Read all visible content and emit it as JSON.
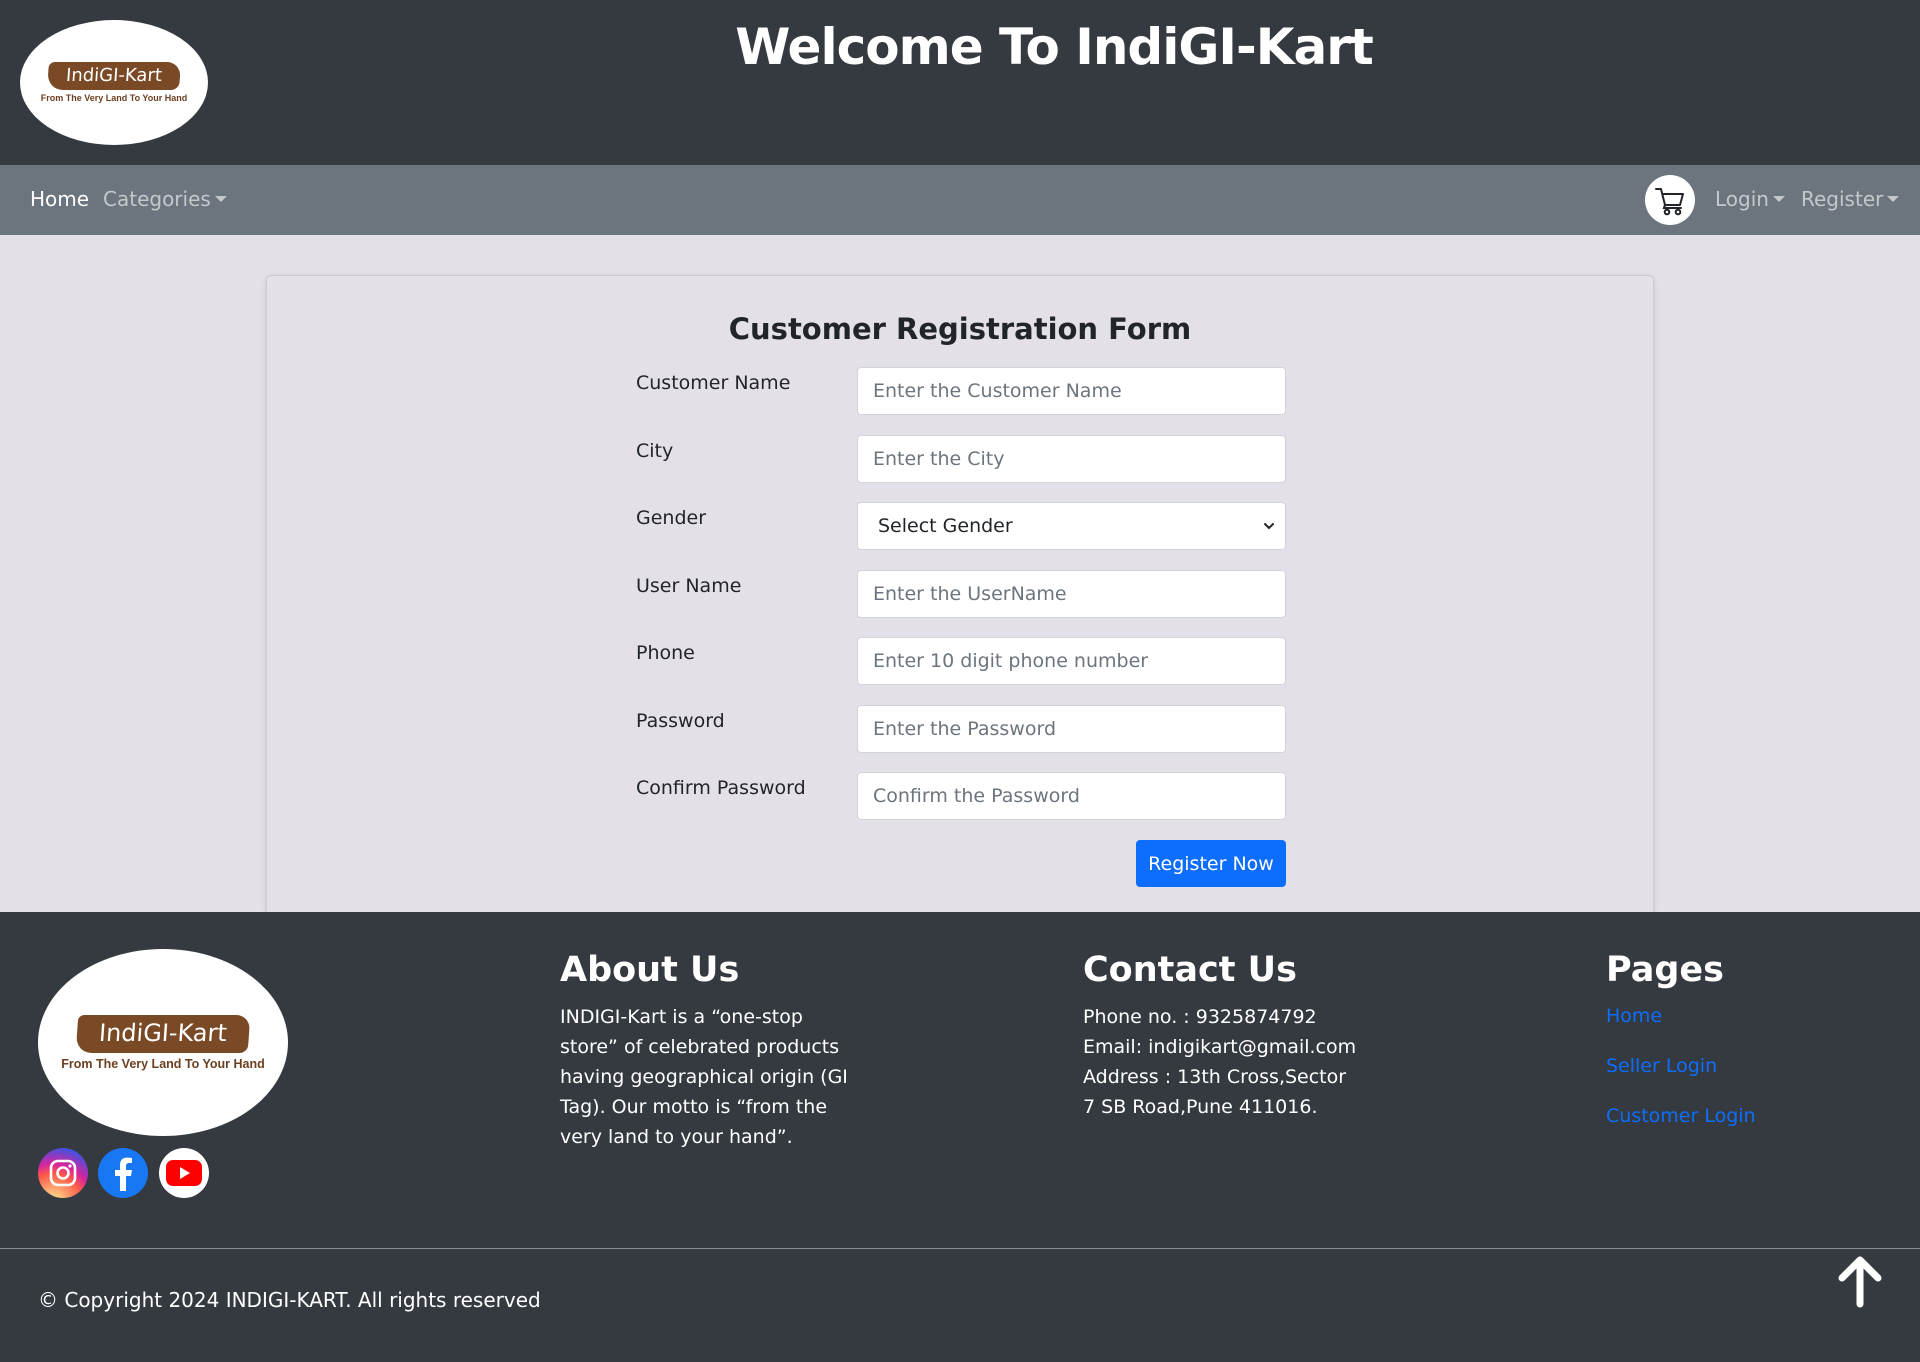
{
  "header": {
    "logo": {
      "brand": "IndiGI-Kart",
      "tagline": "From The Very Land To Your Hand"
    },
    "title": "Welcome To IndiGI-Kart"
  },
  "navbar": {
    "home": "Home",
    "categories": "Categories",
    "login": "Login",
    "register": "Register",
    "cart_icon": "shopping-cart-icon"
  },
  "form": {
    "title": "Customer Registration Form",
    "fields": [
      {
        "label": "Customer Name",
        "placeholder": "Enter the Customer Name"
      },
      {
        "label": "City",
        "placeholder": "Enter the City"
      },
      {
        "label": "Gender",
        "selected": "Select Gender"
      },
      {
        "label": "User Name",
        "placeholder": "Enter the UserName"
      },
      {
        "label": "Phone",
        "placeholder": "Enter 10 digit phone number"
      },
      {
        "label": "Password",
        "placeholder": "Enter the Password"
      },
      {
        "label": "Confirm Password",
        "placeholder": "Confirm the Password"
      }
    ],
    "submit_label": "Register Now"
  },
  "footer": {
    "logo": {
      "brand": "IndiGI-Kart",
      "tagline": "From The Very Land To Your Hand"
    },
    "social": [
      "instagram-icon",
      "facebook-icon",
      "youtube-icon"
    ],
    "about": {
      "heading": "About Us",
      "lines": [
        "INDIGI-Kart is a “one-stop",
        "store” of celebrated products",
        "having geographical origin (GI",
        "Tag). Our motto is “from the",
        "very land to your hand”."
      ]
    },
    "contact": {
      "heading": "Contact Us",
      "lines": [
        "Phone no. : 9325874792",
        "Email: indigikart@gmail.com",
        "Address : 13th Cross,Sector",
        "7 SB Road,Pune 411016."
      ]
    },
    "pages": {
      "heading": "Pages",
      "links": [
        "Home",
        "Seller Login",
        "Customer Login"
      ]
    },
    "copyright": "© Copyright 2024 INDIGI-KART. All rights reserved"
  },
  "colors": {
    "header_bg": "#343a40",
    "navbar_bg": "#6c757d",
    "page_bg": "#e4e0e7",
    "primary": "#0d6efd",
    "logo_brown": "#7a4a27"
  }
}
